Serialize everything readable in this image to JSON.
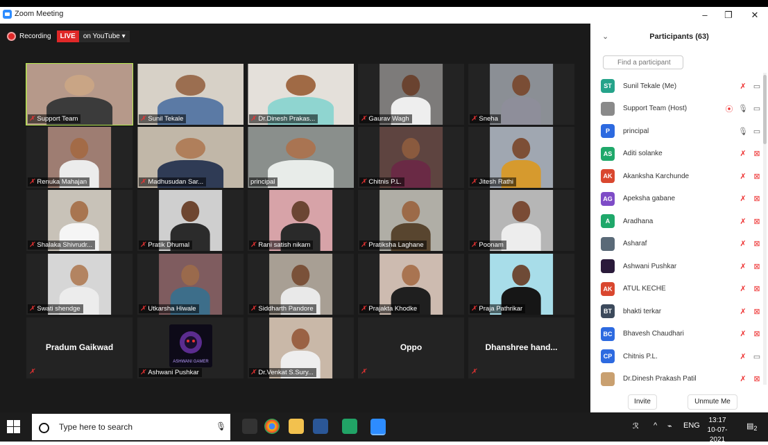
{
  "window": {
    "title": "Zoom Meeting",
    "minimize": "–",
    "restore": "❐",
    "close": "✕"
  },
  "recording": {
    "label": "Recording",
    "live": "LIVE",
    "youtube": "on YouTube ▾"
  },
  "tiles": [
    {
      "name": "Support Team",
      "face": "#c9a585",
      "body": "#3b3b3b",
      "bg": "#b6998a"
    },
    {
      "name": "Sunil Tekale",
      "face": "#9b6e50",
      "body": "#5b7aa5",
      "bg": "#d7d1c7"
    },
    {
      "name": "Dr.Dinesh Prakas...",
      "face": "#a06a45",
      "body": "#8fd5d0",
      "bg": "#e4e0da"
    },
    {
      "name": "Gaurav Wagh",
      "face": "#6a4330",
      "body": "#eeeeee",
      "bg": "#7d7b7a"
    },
    {
      "name": "Sneha",
      "face": "#7a4d35",
      "body": "#8e8e9a",
      "bg": "#8b8f95"
    },
    {
      "name": "Renuka Mahajan",
      "face": "#a36b47",
      "body": "#ececec",
      "bg": "#9e7d72"
    },
    {
      "name": "Madhusudan Sar...",
      "face": "#b07f5b",
      "body": "#2f3b55",
      "bg": "#c1b7a8"
    },
    {
      "name": "principal",
      "face": "#a97452",
      "body": "#e8ece9",
      "bg": "#8a8f8c"
    },
    {
      "name": "Chitnis P.L.",
      "face": "#8a5a3e",
      "body": "#6a2a45",
      "bg": "#5e4440"
    },
    {
      "name": "Jitesh Rathi",
      "face": "#7d4f36",
      "body": "#d69a2e",
      "bg": "#a0a7b1"
    },
    {
      "name": "Shalaka Shivrudr...",
      "face": "#a87550",
      "body": "#f5f5f5",
      "bg": "#c8c2b8"
    },
    {
      "name": "Pratik Dhumal",
      "face": "#6e4630",
      "body": "#2b2b2b",
      "bg": "#cfcfcf"
    },
    {
      "name": "Rani satish nikam",
      "face": "#6b4533",
      "body": "#2a2a2a",
      "bg": "#d7a3a8"
    },
    {
      "name": "Pratiksha Laghane",
      "face": "#9c6a48",
      "body": "#58452f",
      "bg": "#b0aea6"
    },
    {
      "name": "Poonam",
      "face": "#7a4b35",
      "body": "#ededed",
      "bg": "#b6b6b6"
    },
    {
      "name": "Swati shendge",
      "face": "#b38461",
      "body": "#ececec",
      "bg": "#d6d6d6"
    },
    {
      "name": "Utkarsha Hiwale",
      "face": "#9a6a4c",
      "body": "#3d6e8a",
      "bg": "#7f5c5f"
    },
    {
      "name": "Siddharth Pandore",
      "face": "#7a5139",
      "body": "#e9e9e9",
      "bg": "#a89f94"
    },
    {
      "name": "Prajakta Khodke",
      "face": "#a97451",
      "body": "#1f1f1f",
      "bg": "#cdbbb0"
    },
    {
      "name": "Praja Pathrikar",
      "face": "#6e4a36",
      "body": "#161616",
      "bg": "#a8dde9"
    }
  ],
  "text_tiles": [
    {
      "name": "Pradum Gaikwad"
    },
    {
      "name": "Ashwani Pushkar"
    },
    {
      "name": "Dr.Venkat S.Sury..."
    },
    {
      "name": "Oppo"
    },
    {
      "name": "Dhanshree  hand..."
    }
  ],
  "gamer_logo_text": "ASHWANI GAMER",
  "panel": {
    "title": "Participants (63)",
    "search_placeholder": "Find a participant",
    "participants": [
      {
        "initials": "ST",
        "name": "Sunil Tekale (Me)",
        "color": "#25a38a",
        "mic": "🎤̸",
        "cam": "▭"
      },
      {
        "initials": "",
        "name": "Support Team (Host)",
        "color": "#8a8a8a",
        "mic": "🎙",
        "cam": "▭"
      },
      {
        "initials": "P",
        "name": "principal",
        "color": "#2d6ae0",
        "mic": "🎙",
        "cam": "▭"
      },
      {
        "initials": "AS",
        "name": "Aditi solanke",
        "color": "#1fa86a",
        "mic": "🎤̸",
        "cam": "▭̸"
      },
      {
        "initials": "AK",
        "name": "Akanksha Karchunde",
        "color": "#d9472f",
        "mic": "🎤̸",
        "cam": "▭̸"
      },
      {
        "initials": "AG",
        "name": "Apeksha gabane",
        "color": "#7e4cc7",
        "mic": "🎤̸",
        "cam": "▭̸"
      },
      {
        "initials": "A",
        "name": "Aradhana",
        "color": "#1fa86a",
        "mic": "🎤̸",
        "cam": "▭̸"
      },
      {
        "initials": "",
        "name": "Asharaf",
        "color": "#5a6a78",
        "mic": "🎤̸",
        "cam": "▭̸"
      },
      {
        "initials": "",
        "name": "Ashwani Pushkar",
        "color": "#2a1a3a",
        "mic": "🎤̸",
        "cam": "▭̸"
      },
      {
        "initials": "AK",
        "name": "ATUL KECHE",
        "color": "#d9472f",
        "mic": "🎤̸",
        "cam": "▭̸"
      },
      {
        "initials": "BT",
        "name": "bhakti terkar",
        "color": "#3c4a5c",
        "mic": "🎤̸",
        "cam": "▭̸"
      },
      {
        "initials": "BC",
        "name": "Bhavesh Chaudhari",
        "color": "#2d6ae0",
        "mic": "🎤̸",
        "cam": "▭̸"
      },
      {
        "initials": "CP",
        "name": "Chitnis P.L.",
        "color": "#2d6ae0",
        "mic": "🎤̸",
        "cam": "▭"
      },
      {
        "initials": "",
        "name": "Dr.Dinesh Prakash Patil",
        "color": "#c9a070",
        "mic": "🎤̸",
        "cam": "▭̸"
      }
    ],
    "invite": "Invite",
    "unmute_me": "Unmute Me"
  },
  "taskbar": {
    "search_placeholder": "Type here to search",
    "lang": "ENG",
    "time": "13:17",
    "date": "10-07-2021",
    "notif_count": "2"
  }
}
